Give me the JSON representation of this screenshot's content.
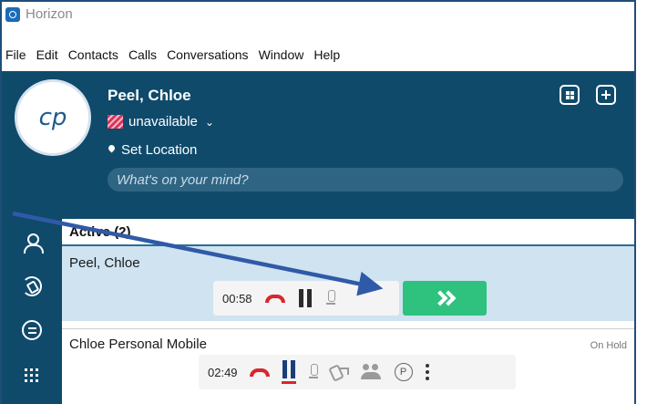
{
  "app": {
    "title": "Horizon"
  },
  "menu": [
    "File",
    "Edit",
    "Contacts",
    "Calls",
    "Conversations",
    "Window",
    "Help"
  ],
  "profile": {
    "initials": "cp",
    "name": "Peel, Chloe",
    "status": "unavailable",
    "location": "Set Location",
    "mind_placeholder": "What's on your mind?"
  },
  "active": {
    "heading": "Active (2)"
  },
  "calls": [
    {
      "name": "Peel, Chloe",
      "timer": "00:58"
    },
    {
      "name": "Chloe Personal Mobile",
      "timer": "02:49",
      "badge": "On Hold",
      "park_label": "P"
    }
  ],
  "colors": {
    "header_bg": "#0f4a6b",
    "selected_row": "#cfe3f0",
    "answer_green": "#2ec27e",
    "hangup_red": "#d9262c",
    "arrow_blue": "#2f5aa8"
  }
}
